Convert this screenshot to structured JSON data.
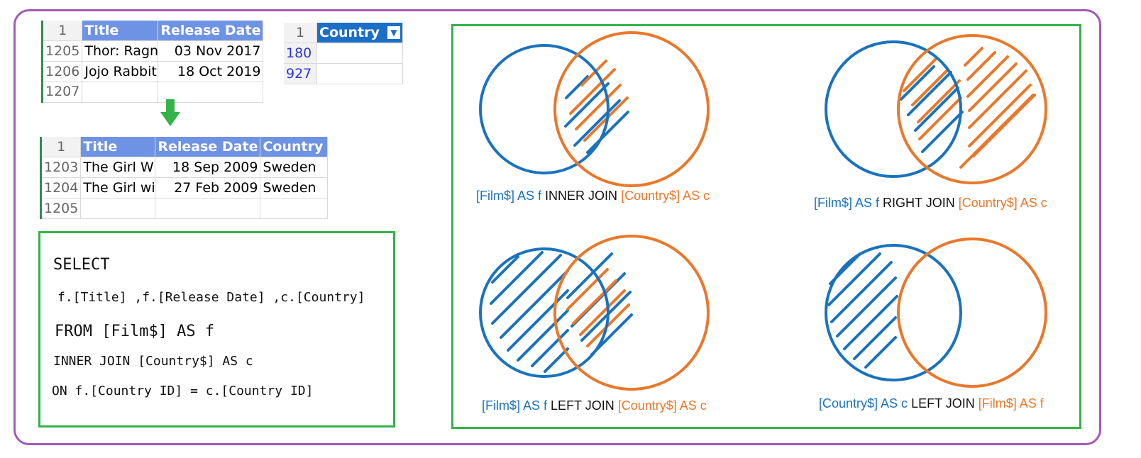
{
  "film_table": {
    "header_row": "1",
    "columns": [
      "Title",
      "Release Date"
    ],
    "rows": [
      {
        "rownum": "1205",
        "title": "Thor: Ragn",
        "date": "03 Nov 2017"
      },
      {
        "rownum": "1206",
        "title": "Jojo Rabbit",
        "date": "18 Oct 2019"
      },
      {
        "rownum": "1207",
        "title": "",
        "date": ""
      }
    ]
  },
  "country_table": {
    "header_row": "1",
    "column": "Country",
    "ids": [
      "180",
      "927"
    ]
  },
  "joined_table": {
    "header_row": "1",
    "columns": [
      "Title",
      "Release Date",
      "Country"
    ],
    "rows": [
      {
        "rownum": "1203",
        "title": "The Girl W",
        "date": "18 Sep 2009",
        "country": "Sweden"
      },
      {
        "rownum": "1204",
        "title": "The Girl wi",
        "date": "27 Feb 2009",
        "country": "Sweden"
      },
      {
        "rownum": "1205",
        "title": "",
        "date": "",
        "country": ""
      }
    ]
  },
  "sql": {
    "select": "SELECT",
    "fields": "f.[Title] ,f.[Release Date] ,c.[Country]",
    "from": "FROM [Film$] AS f",
    "join": "INNER JOIN [Country$] AS c",
    "on": "ON f.[Country ID] = c.[Country ID]"
  },
  "venn": {
    "inner": {
      "left": "[Film$] AS f",
      "op": "INNER JOIN",
      "right": "[Country$] AS c"
    },
    "right": {
      "left": "[Film$] AS f",
      "op": "RIGHT JOIN",
      "right": "[Country$] AS c"
    },
    "left": {
      "left": "[Film$] AS f",
      "op": "LEFT JOIN",
      "right": "[Country$] AS c"
    },
    "left_rev": {
      "left": "[Country$] AS c",
      "op": "LEFT JOIN",
      "right": "[Film$] AS f"
    }
  },
  "colors": {
    "blue": "#1a72bd",
    "orange": "#e9782b",
    "green": "#33b34a",
    "purple": "#a05ab8",
    "header": "#6f93e4"
  }
}
